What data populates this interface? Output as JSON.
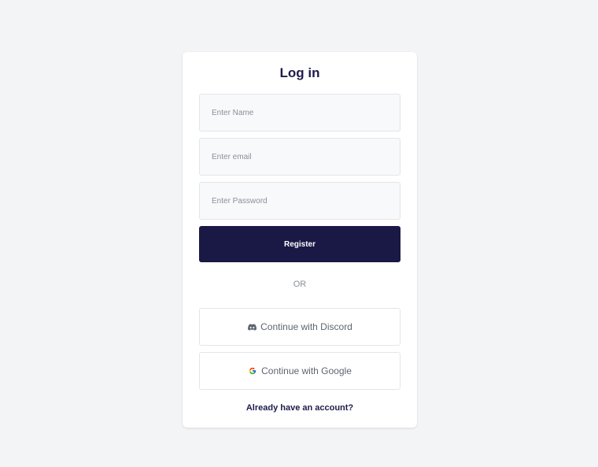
{
  "form": {
    "title": "Log in",
    "name_placeholder": "Enter Name",
    "email_placeholder": "Enter email",
    "password_placeholder": "Enter Password",
    "register_label": "Register",
    "or_label": "OR",
    "discord_label": "Continue with Discord",
    "google_label": "Continue with Google",
    "login_link": "Already have an account?"
  },
  "icons": {
    "discord": "discord-icon",
    "google": "google-icon"
  },
  "colors": {
    "background": "#f3f4f6",
    "card": "#ffffff",
    "primary": "#1a1845",
    "title": "#1e1b4b",
    "muted": "#8a8f98"
  }
}
